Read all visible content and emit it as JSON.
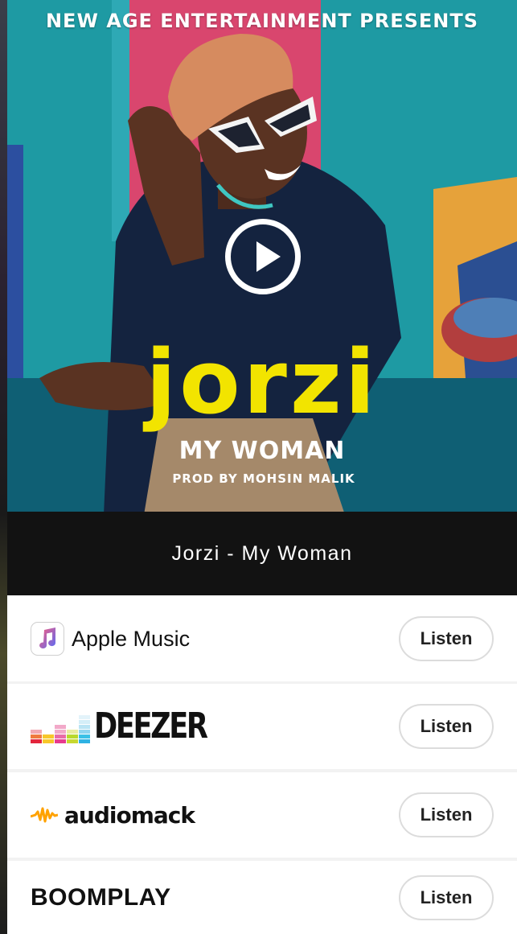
{
  "cover": {
    "presents_text": "NEW AGE ENTERTAINMENT PRESENTS",
    "artist_text": "JORZI",
    "song_text": "MY WOMAN",
    "producer_text": "PROD BY MOHSIN MALIK",
    "play_icon": "play-circle-icon"
  },
  "track": {
    "title": "Jorzi - My Woman"
  },
  "services": [
    {
      "name": "Apple Music",
      "icon": "apple-music-icon",
      "button": "Listen"
    },
    {
      "name": "DEEZER",
      "icon": "deezer-bars-icon",
      "button": "Listen"
    },
    {
      "name": "audiomack",
      "icon": "audiomack-waveform-icon",
      "button": "Listen",
      "accent": "#ffa200"
    },
    {
      "name": "BOOMPLAY",
      "button": "Listen"
    }
  ],
  "colors": {
    "cover_teal": "#1e9aa3",
    "cover_pink": "#d9466e",
    "artist_yellow": "#f2e400",
    "title_bar": "#121212"
  }
}
